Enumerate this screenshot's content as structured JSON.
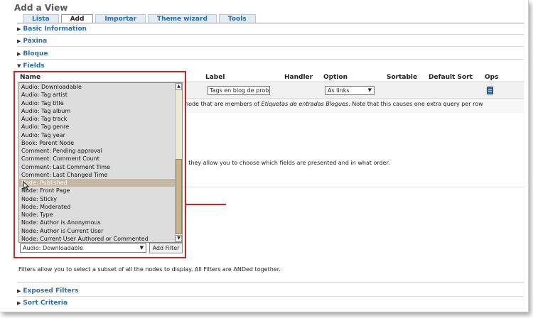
{
  "page": {
    "title": "Add a View"
  },
  "tabs": [
    {
      "label": "Lista",
      "active": false
    },
    {
      "label": "Add",
      "active": true
    },
    {
      "label": "Importar",
      "active": false
    },
    {
      "label": "Theme wizard",
      "active": false
    },
    {
      "label": "Tools",
      "active": false
    }
  ],
  "sections": {
    "basic": "Basic Information",
    "paxina": "Páxina",
    "bloque": "Bloque",
    "fields": "Fields",
    "exposed": "Exposed Filters",
    "sort": "Sort Criteria"
  },
  "fields_table": {
    "headers": {
      "name": "Name",
      "label": "Label",
      "handler": "Handler",
      "option": "Option",
      "sortable": "Sortable",
      "default_sort": "Default Sort",
      "ops": "Ops"
    },
    "row": {
      "label_value": "Tags en blog de prob",
      "option_value": "As links"
    },
    "desc_start": "node that are members of ",
    "desc_em": "Etiquetas de entradas Blogues",
    "desc_end": ". Note that this causes one extra query per row",
    "fields_note": "; they allow you to choose which fields are presented and in what order."
  },
  "filters": {
    "note": "Filters allow you to select a subset of all the nodes to display. All Filters are ANDed together.",
    "selected": "Audio: Downloadable",
    "add_button": "Add Filter",
    "options": [
      "Audio: Downloadable",
      "Audio: Tag artist",
      "Audio: Tag title",
      "Audio: Tag album",
      "Audio: Tag track",
      "Audio: Tag genre",
      "Audio: Tag year",
      "Book: Parent Node",
      "Comment: Pending approval",
      "Comment: Comment Count",
      "Comment: Last Comment Time",
      "Comment: Last Changed Time",
      "Node: Published",
      "Node: Front Page",
      "Node: Sticky",
      "Node: Moderated",
      "Node: Type",
      "Node: Author is Anonymous",
      "Node: Author is Current User",
      "Node: Current User Authored or Commented"
    ],
    "highlighted_index": 12
  },
  "colors": {
    "link": "#2a6db3",
    "annotation": "#d42020",
    "highlight": "#c5b8a6"
  },
  "icons": {
    "ops": "edit-icon",
    "cursor": "mouse-cursor-icon"
  }
}
